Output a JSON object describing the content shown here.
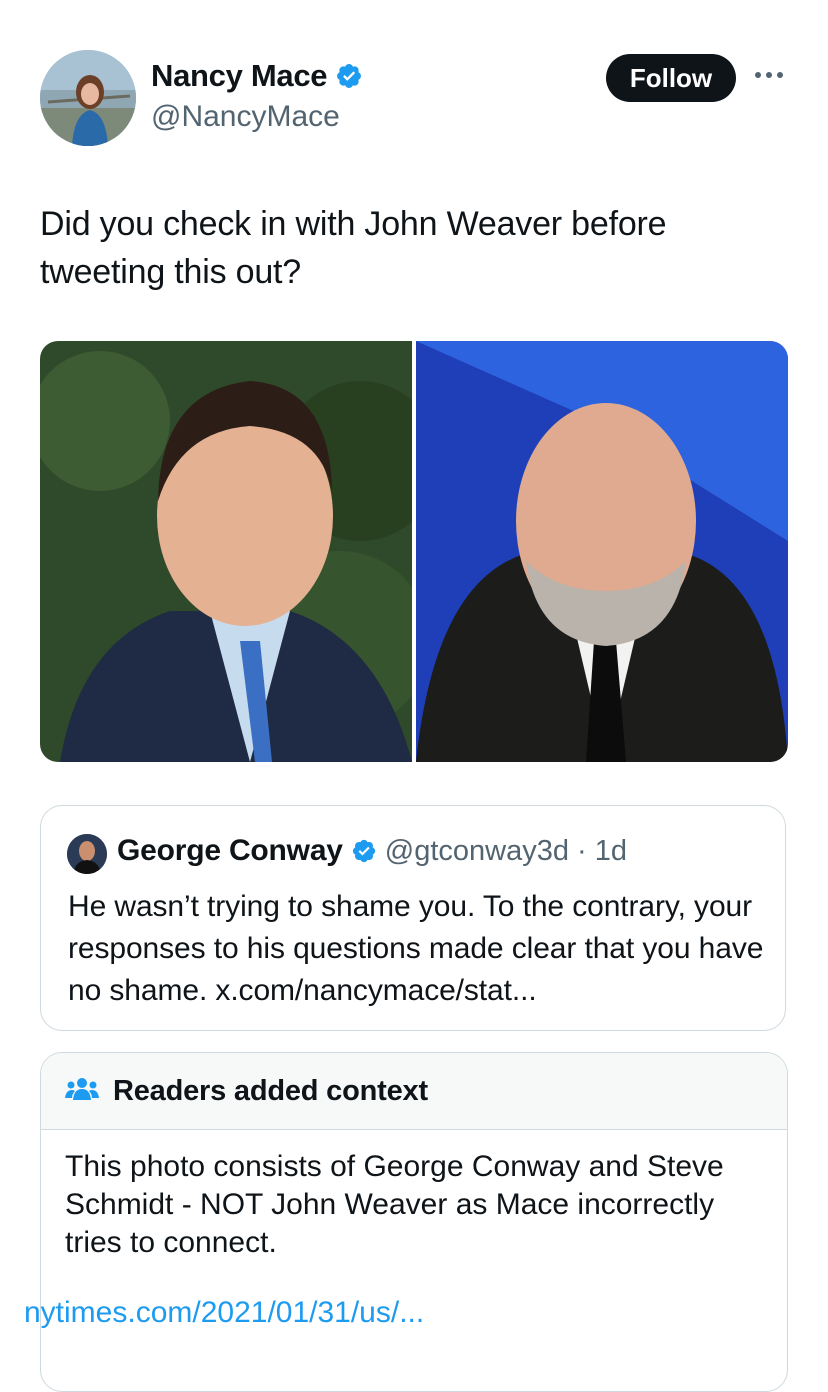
{
  "author": {
    "display_name": "Nancy Mace",
    "handle": "@NancyMace",
    "verified_icon": "verified-badge-icon",
    "avatar_icon": "avatar"
  },
  "actions": {
    "follow_label": "Follow",
    "more_icon": "more-icon"
  },
  "tweet": {
    "text": "Did you check in with John Weaver before tweeting this out?"
  },
  "media": {
    "photo_count": 2
  },
  "quote": {
    "display_name": "George Conway",
    "handle": "@gtconway3d",
    "separator": "·",
    "time": "1d",
    "text": "He wasn’t trying to shame you.  To the contrary, your responses to his questions made clear that you have no shame. x.com/nancymace/stat..."
  },
  "notes": {
    "title": "Readers added context",
    "icon": "people-icon",
    "body": "This photo consists of George Conway and Steve Schmidt - NOT John Weaver as Mace incorrectly tries to connect.",
    "link": "nytimes.com/2021/01/31/us/..."
  },
  "colors": {
    "accent": "#1d9bf0",
    "text": "#0f1419",
    "secondary": "#536471",
    "border": "#cfd9de"
  }
}
